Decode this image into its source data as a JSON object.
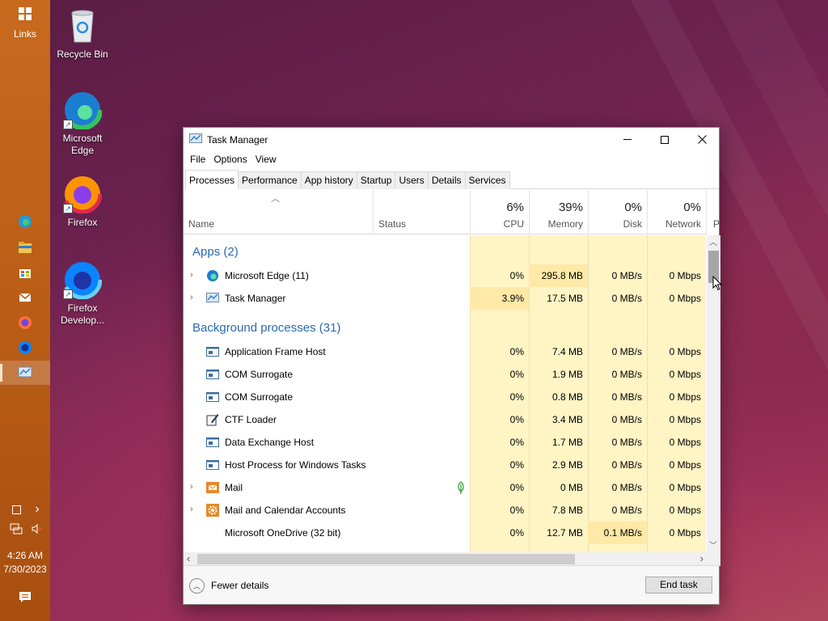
{
  "desktop": {
    "icons": [
      {
        "label": "Recycle Bin"
      },
      {
        "label": "Microsoft Edge"
      },
      {
        "label": "Firefox"
      },
      {
        "label": "Firefox Develop..."
      }
    ]
  },
  "taskbar": {
    "links_label": "Links",
    "time": "4:26 AM",
    "date": "7/30/2023"
  },
  "window": {
    "title": "Task Manager",
    "menu": [
      "File",
      "Options",
      "View"
    ],
    "tabs": [
      "Processes",
      "Performance",
      "App history",
      "Startup",
      "Users",
      "Details",
      "Services"
    ],
    "active_tab": "Processes",
    "columns": {
      "name": "Name",
      "status": "Status",
      "cpu": {
        "pct": "6%",
        "label": "CPU"
      },
      "memory": {
        "pct": "39%",
        "label": "Memory"
      },
      "disk": {
        "pct": "0%",
        "label": "Disk"
      },
      "network": {
        "pct": "0%",
        "label": "Network"
      },
      "power_partial": "P"
    },
    "groups": {
      "apps": "Apps (2)",
      "background": "Background processes (31)"
    },
    "apps": [
      {
        "name": "Microsoft Edge (11)",
        "icon": "edge-icon",
        "cpu": "0%",
        "memory": "295.8 MB",
        "disk": "0 MB/s",
        "network": "0 Mbps"
      },
      {
        "name": "Task Manager",
        "icon": "task-manager-icon",
        "cpu": "3.9%",
        "memory": "17.5 MB",
        "disk": "0 MB/s",
        "network": "0 Mbps"
      }
    ],
    "background": [
      {
        "name": "Application Frame Host",
        "icon": "window-icon",
        "expander": false,
        "cpu": "0%",
        "memory": "7.4 MB",
        "disk": "0 MB/s",
        "network": "0 Mbps"
      },
      {
        "name": "COM Surrogate",
        "icon": "window-icon",
        "expander": false,
        "cpu": "0%",
        "memory": "1.9 MB",
        "disk": "0 MB/s",
        "network": "0 Mbps"
      },
      {
        "name": "COM Surrogate",
        "icon": "window-icon",
        "expander": false,
        "cpu": "0%",
        "memory": "0.8 MB",
        "disk": "0 MB/s",
        "network": "0 Mbps"
      },
      {
        "name": "CTF Loader",
        "icon": "pen-icon",
        "expander": false,
        "cpu": "0%",
        "memory": "3.4 MB",
        "disk": "0 MB/s",
        "network": "0 Mbps"
      },
      {
        "name": "Data Exchange Host",
        "icon": "window-icon",
        "expander": false,
        "cpu": "0%",
        "memory": "1.7 MB",
        "disk": "0 MB/s",
        "network": "0 Mbps"
      },
      {
        "name": "Host Process for Windows Tasks",
        "icon": "window-icon",
        "expander": false,
        "cpu": "0%",
        "memory": "2.9 MB",
        "disk": "0 MB/s",
        "network": "0 Mbps"
      },
      {
        "name": "Mail",
        "icon": "mail-icon",
        "expander": true,
        "suspended": true,
        "cpu": "0%",
        "memory": "0 MB",
        "disk": "0 MB/s",
        "network": "0 Mbps"
      },
      {
        "name": "Mail and Calendar Accounts",
        "icon": "gear-icon",
        "expander": true,
        "cpu": "0%",
        "memory": "7.8 MB",
        "disk": "0 MB/s",
        "network": "0 Mbps"
      },
      {
        "name": "Microsoft OneDrive (32 bit)",
        "icon": "none",
        "expander": false,
        "cpu": "0%",
        "memory": "12.7 MB",
        "disk": "0.1 MB/s",
        "network": "0 Mbps"
      }
    ],
    "footer": {
      "fewer_details": "Fewer details",
      "end_task": "End task"
    }
  },
  "colors": {
    "heat_light": "#fff4c4",
    "heat_medium": "#ffe9a8",
    "group_blue": "#2a6ab3",
    "taskbar": "#b85c16"
  }
}
